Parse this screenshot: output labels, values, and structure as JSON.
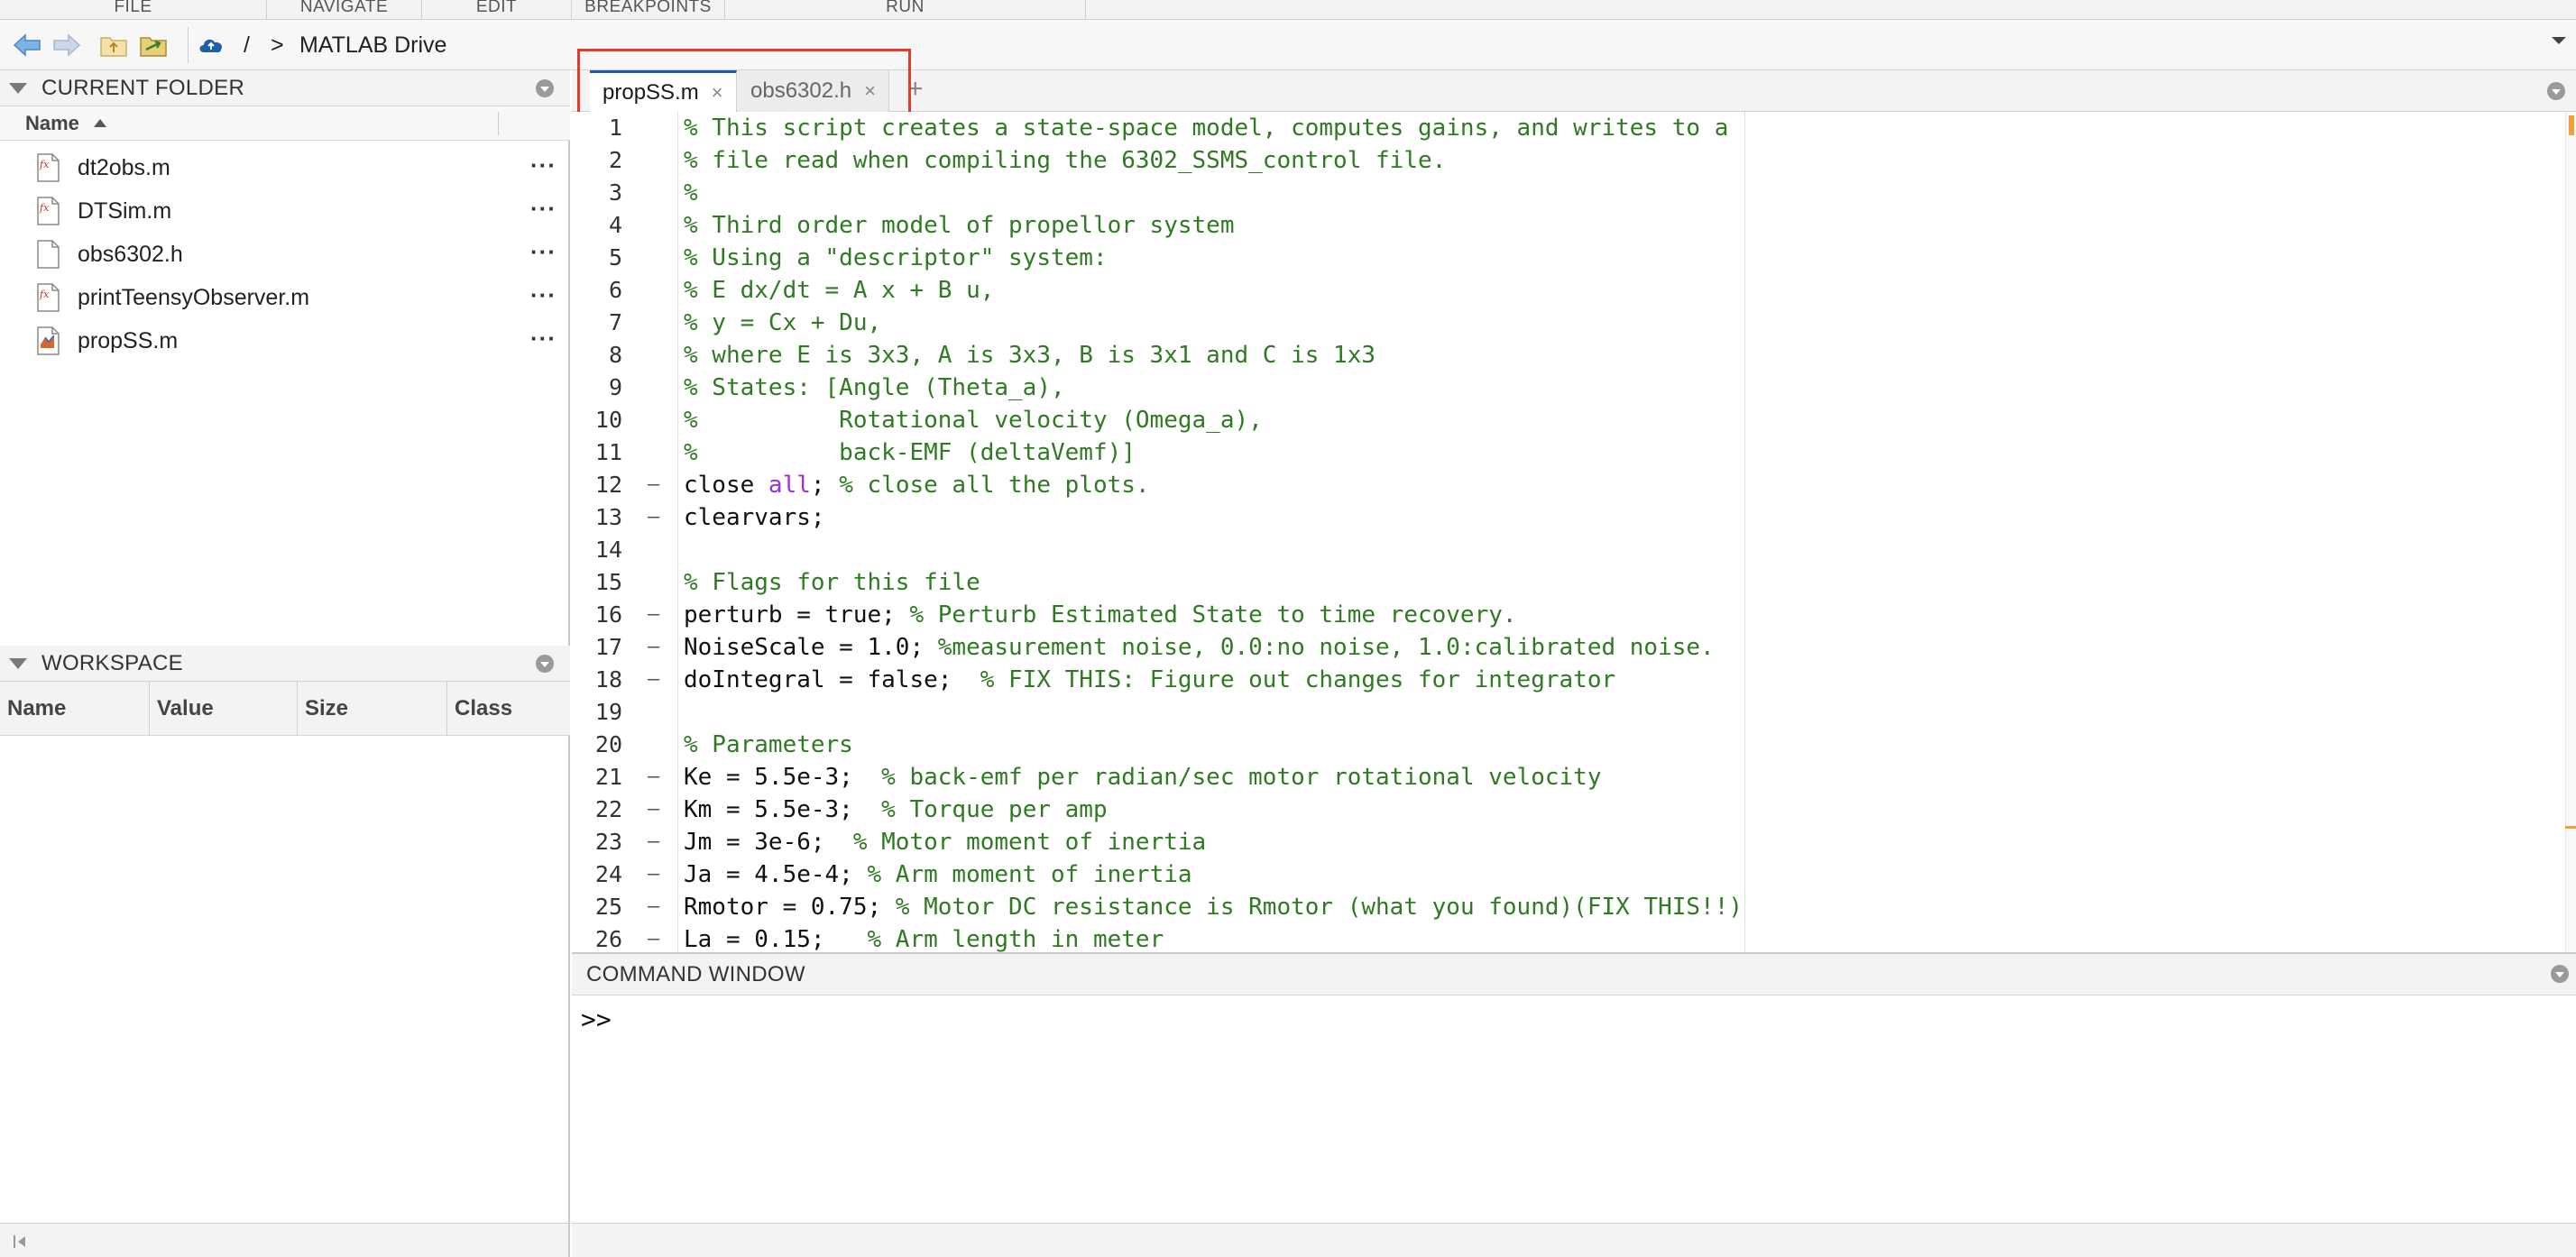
{
  "toolstrip": {
    "tabs": [
      "FILE",
      "NAVIGATE",
      "EDIT",
      "BREAKPOINTS",
      "RUN"
    ]
  },
  "address": {
    "root": "/",
    "separator": ">",
    "location": "MATLAB Drive"
  },
  "current_folder": {
    "title": "CURRENT FOLDER",
    "column_name": "Name",
    "files": [
      {
        "name": "dt2obs.m",
        "icon": "matlab-function-icon"
      },
      {
        "name": "DTSim.m",
        "icon": "matlab-function-icon"
      },
      {
        "name": "obs6302.h",
        "icon": "text-file-icon"
      },
      {
        "name": "printTeensyObserver.m",
        "icon": "matlab-function-icon"
      },
      {
        "name": "propSS.m",
        "icon": "matlab-script-icon"
      }
    ],
    "more_label": "···"
  },
  "workspace": {
    "title": "WORKSPACE",
    "columns": [
      "Name",
      "Value",
      "Size",
      "Class"
    ]
  },
  "editor": {
    "tabs": [
      {
        "label": "propSS.m",
        "active": true
      },
      {
        "label": "obs6302.h",
        "active": false
      }
    ],
    "close_glyph": "×",
    "add_glyph": "+",
    "lines": [
      {
        "n": "1",
        "dash": "",
        "segments": [
          {
            "t": "% This script creates a state-space model, computes gains, and writes to a",
            "c": "cm"
          }
        ]
      },
      {
        "n": "2",
        "dash": "",
        "segments": [
          {
            "t": "% file read when compiling the 6302_SSMS_control file.",
            "c": "cm"
          }
        ]
      },
      {
        "n": "3",
        "dash": "",
        "segments": [
          {
            "t": "%",
            "c": "cm"
          }
        ]
      },
      {
        "n": "4",
        "dash": "",
        "segments": [
          {
            "t": "% Third order model of propellor system",
            "c": "cm"
          }
        ]
      },
      {
        "n": "5",
        "dash": "",
        "segments": [
          {
            "t": "% Using a \"descriptor\" system:",
            "c": "cm"
          }
        ]
      },
      {
        "n": "6",
        "dash": "",
        "segments": [
          {
            "t": "% E dx/dt = A x + B u,",
            "c": "cm"
          }
        ]
      },
      {
        "n": "7",
        "dash": "",
        "segments": [
          {
            "t": "% y = Cx + Du,",
            "c": "cm"
          }
        ]
      },
      {
        "n": "8",
        "dash": "",
        "segments": [
          {
            "t": "% where E is 3x3, A is 3x3, B is 3x1 and C is 1x3",
            "c": "cm"
          }
        ]
      },
      {
        "n": "9",
        "dash": "",
        "segments": [
          {
            "t": "% States: [Angle (Theta_a),",
            "c": "cm"
          }
        ]
      },
      {
        "n": "10",
        "dash": "",
        "segments": [
          {
            "t": "%          Rotational velocity (Omega_a),",
            "c": "cm"
          }
        ]
      },
      {
        "n": "11",
        "dash": "",
        "segments": [
          {
            "t": "%          back-EMF (deltaVemf)]",
            "c": "cm"
          }
        ]
      },
      {
        "n": "12",
        "dash": "–",
        "segments": [
          {
            "t": "close ",
            "c": "tx"
          },
          {
            "t": "all",
            "c": "kw"
          },
          {
            "t": "; ",
            "c": "tx"
          },
          {
            "t": "% close all the plots.",
            "c": "cm"
          }
        ]
      },
      {
        "n": "13",
        "dash": "–",
        "segments": [
          {
            "t": "clearvars;",
            "c": "tx"
          }
        ]
      },
      {
        "n": "14",
        "dash": "",
        "segments": []
      },
      {
        "n": "15",
        "dash": "",
        "segments": [
          {
            "t": "% Flags for this file",
            "c": "cm"
          }
        ]
      },
      {
        "n": "16",
        "dash": "–",
        "segments": [
          {
            "t": "perturb = true; ",
            "c": "tx"
          },
          {
            "t": "% Perturb Estimated State to time recovery.",
            "c": "cm"
          }
        ]
      },
      {
        "n": "17",
        "dash": "–",
        "segments": [
          {
            "t": "NoiseScale = 1.0; ",
            "c": "tx"
          },
          {
            "t": "%measurement noise, 0.0:no noise, 1.0:calibrated noise.",
            "c": "cm"
          }
        ]
      },
      {
        "n": "18",
        "dash": "–",
        "segments": [
          {
            "t": "doIntegral = false;  ",
            "c": "tx"
          },
          {
            "t": "% FIX THIS: Figure out changes for integrator",
            "c": "cm"
          }
        ]
      },
      {
        "n": "19",
        "dash": "",
        "segments": []
      },
      {
        "n": "20",
        "dash": "",
        "segments": [
          {
            "t": "% Parameters",
            "c": "cm"
          }
        ]
      },
      {
        "n": "21",
        "dash": "–",
        "segments": [
          {
            "t": "Ke = 5.5e-3;  ",
            "c": "tx"
          },
          {
            "t": "% back-emf per radian/sec motor rotational velocity",
            "c": "cm"
          }
        ]
      },
      {
        "n": "22",
        "dash": "–",
        "segments": [
          {
            "t": "Km = 5.5e-3;  ",
            "c": "tx"
          },
          {
            "t": "% Torque per amp",
            "c": "cm"
          }
        ]
      },
      {
        "n": "23",
        "dash": "–",
        "segments": [
          {
            "t": "Jm = 3e-6;  ",
            "c": "tx"
          },
          {
            "t": "% Motor moment of inertia",
            "c": "cm"
          }
        ]
      },
      {
        "n": "24",
        "dash": "–",
        "segments": [
          {
            "t": "Ja = 4.5e-4; ",
            "c": "tx"
          },
          {
            "t": "% Arm moment of inertia",
            "c": "cm"
          }
        ]
      },
      {
        "n": "25",
        "dash": "–",
        "segments": [
          {
            "t": "Rmotor = 0.75; ",
            "c": "tx"
          },
          {
            "t": "% Motor DC resistance is Rmotor (what you found)(FIX THIS!!)",
            "c": "cm"
          }
        ]
      },
      {
        "n": "26",
        "dash": "–",
        "segments": [
          {
            "t": "La = 0.15;   ",
            "c": "tx"
          },
          {
            "t": "% Arm length in meter",
            "c": "cm"
          }
        ]
      }
    ]
  },
  "command_window": {
    "title": "COMMAND WINDOW",
    "prompt": ">>"
  },
  "colors": {
    "comment": "#2f7a22",
    "keyword": "#9b30d9",
    "highlight": "#e23b2e",
    "active_tab_accent": "#1b5ea8"
  }
}
